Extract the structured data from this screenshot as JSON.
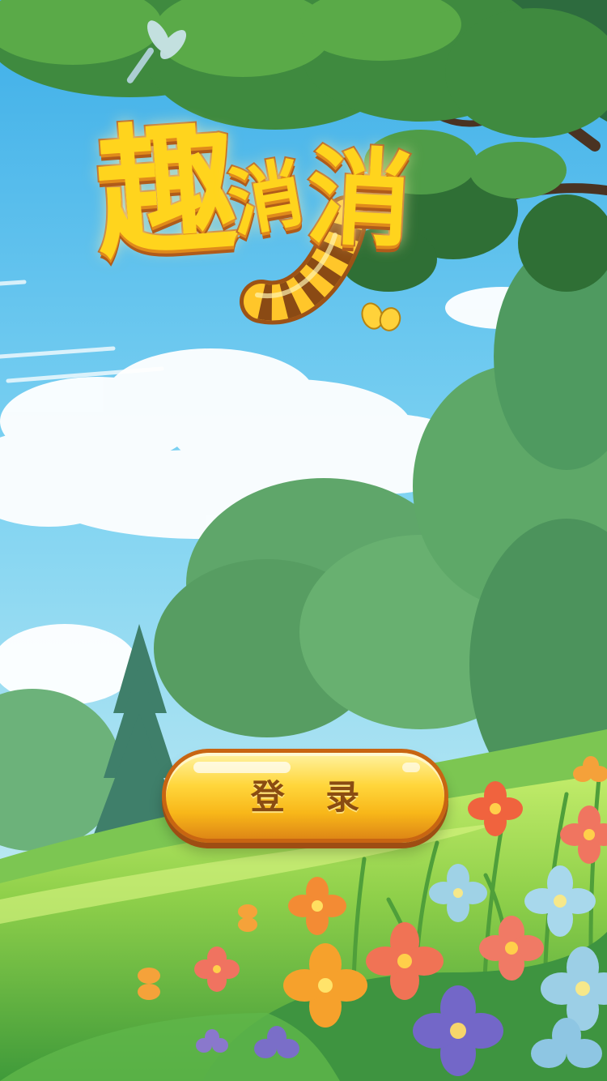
{
  "logo": {
    "title_chars": [
      "趣",
      "消",
      "消"
    ]
  },
  "login": {
    "label": "登 录"
  },
  "colors": {
    "sky_top": "#4fb8ec",
    "sky_bottom": "#cdeef7",
    "logo_fill": "#ffd41d",
    "logo_outline": "#b35a18",
    "button_fill": "#ffd63b",
    "button_text": "#8a4c12",
    "grass": "#8fd04a"
  },
  "decorations": {
    "sky_creature": "dragonfly-icon",
    "small_creature": "butterfly-icon",
    "plants": [
      "tree-icon",
      "pine-tree-icon",
      "flower-icon"
    ]
  }
}
